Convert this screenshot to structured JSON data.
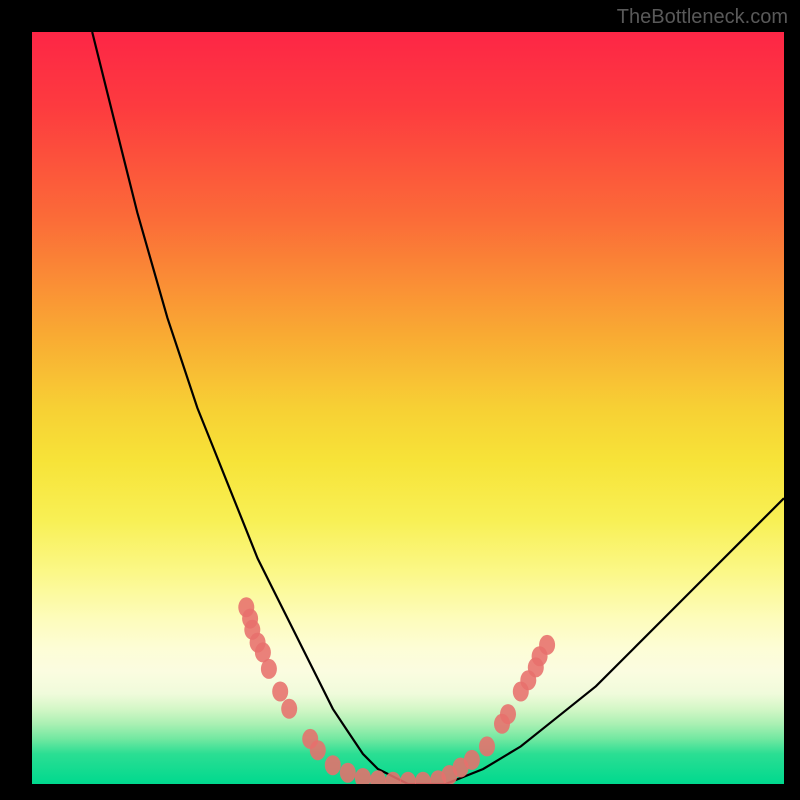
{
  "watermark": "TheBottleneck.com",
  "chart_data": {
    "type": "line",
    "title": "",
    "xlabel": "",
    "ylabel": "",
    "xlim": [
      0,
      100
    ],
    "ylim": [
      0,
      100
    ],
    "grid": false,
    "legend": false,
    "series": [
      {
        "name": "bottleneck-curve",
        "x": [
          8,
          10,
          12,
          14,
          16,
          18,
          20,
          22,
          24,
          26,
          28,
          30,
          32,
          34,
          36,
          38,
          40,
          42,
          44,
          46,
          48,
          50,
          55,
          60,
          65,
          70,
          75,
          80,
          85,
          90,
          95,
          100
        ],
        "y": [
          100,
          92,
          84,
          76,
          69,
          62,
          56,
          50,
          45,
          40,
          35,
          30,
          26,
          22,
          18,
          14,
          10,
          7,
          4,
          2,
          1,
          0,
          0,
          2,
          5,
          9,
          13,
          18,
          23,
          28,
          33,
          38
        ],
        "color": "#000000"
      }
    ],
    "markers": [
      {
        "x": 28.5,
        "y": 23.5
      },
      {
        "x": 29.0,
        "y": 22.0
      },
      {
        "x": 29.3,
        "y": 20.5
      },
      {
        "x": 30.0,
        "y": 18.8
      },
      {
        "x": 30.7,
        "y": 17.5
      },
      {
        "x": 31.5,
        "y": 15.3
      },
      {
        "x": 33.0,
        "y": 12.3
      },
      {
        "x": 34.2,
        "y": 10.0
      },
      {
        "x": 37.0,
        "y": 6.0
      },
      {
        "x": 38.0,
        "y": 4.5
      },
      {
        "x": 40.0,
        "y": 2.5
      },
      {
        "x": 42.0,
        "y": 1.5
      },
      {
        "x": 44.0,
        "y": 0.8
      },
      {
        "x": 46.0,
        "y": 0.5
      },
      {
        "x": 48.0,
        "y": 0.3
      },
      {
        "x": 50.0,
        "y": 0.3
      },
      {
        "x": 52.0,
        "y": 0.3
      },
      {
        "x": 54.0,
        "y": 0.5
      },
      {
        "x": 55.5,
        "y": 1.2
      },
      {
        "x": 57.0,
        "y": 2.2
      },
      {
        "x": 58.5,
        "y": 3.2
      },
      {
        "x": 60.5,
        "y": 5.0
      },
      {
        "x": 62.5,
        "y": 8.0
      },
      {
        "x": 63.3,
        "y": 9.3
      },
      {
        "x": 65.0,
        "y": 12.3
      },
      {
        "x": 66.0,
        "y": 13.8
      },
      {
        "x": 67.0,
        "y": 15.5
      },
      {
        "x": 67.5,
        "y": 17.0
      },
      {
        "x": 68.5,
        "y": 18.5
      }
    ],
    "marker_color": "#e76f6c",
    "gradient_stops": [
      {
        "pos": 0,
        "color": "#fd2646"
      },
      {
        "pos": 25,
        "color": "#fb6c38"
      },
      {
        "pos": 50,
        "color": "#f7d034"
      },
      {
        "pos": 72,
        "color": "#fbf889"
      },
      {
        "pos": 88,
        "color": "#d4f7c7"
      },
      {
        "pos": 100,
        "color": "#00d98e"
      }
    ]
  }
}
